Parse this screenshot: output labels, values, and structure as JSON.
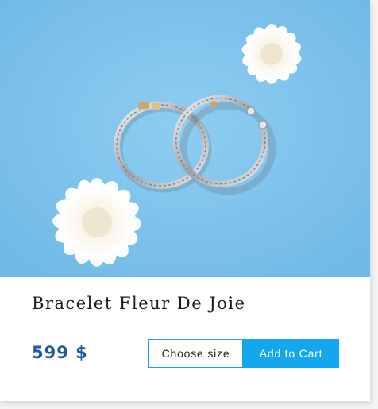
{
  "product": {
    "name": "Bracelet Fleur De Joie",
    "price": "599 $",
    "image_alt": "Two twisted cable hoop bracelets with white flowers on a light blue background"
  },
  "actions": {
    "choose_size_label": "Choose size",
    "add_to_cart_label": "Add to Cart"
  },
  "colors": {
    "accent": "#12a7ee",
    "price": "#1e5b9a",
    "photo_background": "#7fc3ec"
  }
}
